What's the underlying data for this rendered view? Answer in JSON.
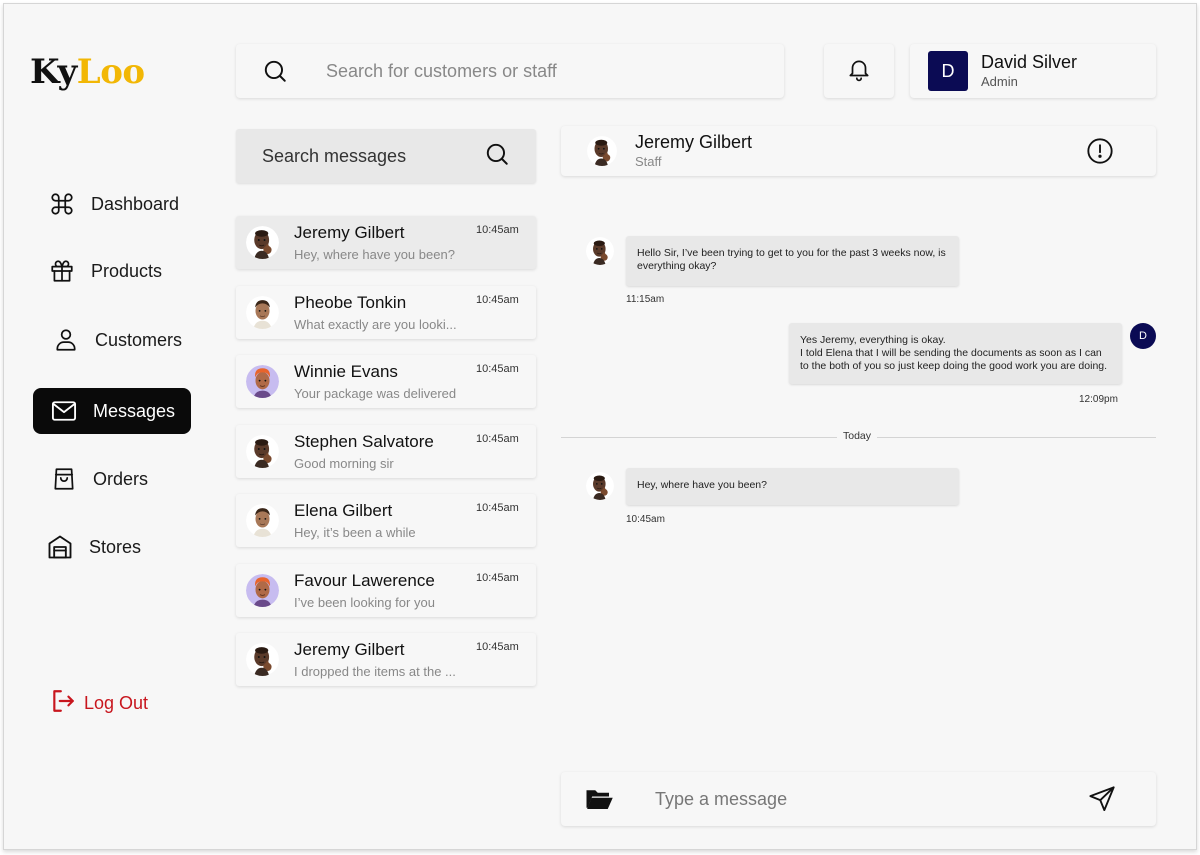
{
  "brand": {
    "part1": "Ky",
    "part2": "Loo"
  },
  "sidebar": {
    "items": [
      {
        "label": "Dashboard",
        "icon": "command-icon"
      },
      {
        "label": "Products",
        "icon": "gift-icon"
      },
      {
        "label": "Customers",
        "icon": "user-icon"
      },
      {
        "label": "Messages",
        "icon": "mail-icon",
        "active": true
      },
      {
        "label": "Orders",
        "icon": "shopping-bag-icon"
      },
      {
        "label": "Stores",
        "icon": "store-icon"
      }
    ],
    "logout": "Log Out"
  },
  "topbar": {
    "search_placeholder": "Search for customers or staff",
    "user": {
      "initial": "D",
      "name": "David Silver",
      "role": "Admin"
    }
  },
  "messages_search": {
    "placeholder": "Search messages"
  },
  "conversations": [
    {
      "name": "Jeremy Gilbert",
      "preview": "Hey, where have you been?",
      "time": "10:45am",
      "active": true
    },
    {
      "name": "Pheobe Tonkin",
      "preview": "What exactly are you looki...",
      "time": "10:45am"
    },
    {
      "name": "Winnie Evans",
      "preview": "Your package was delivered",
      "time": "10:45am"
    },
    {
      "name": "Stephen Salvatore",
      "preview": "Good morning sir",
      "time": "10:45am"
    },
    {
      "name": "Elena Gilbert",
      "preview": "Hey, it’s been a while",
      "time": "10:45am"
    },
    {
      "name": "Favour Lawerence",
      "preview": "I’ve been looking for you",
      "time": "10:45am"
    },
    {
      "name": "Jeremy Gilbert",
      "preview": "I dropped the items at the ...",
      "time": "10:45am"
    }
  ],
  "chat": {
    "contact": {
      "name": "Jeremy Gilbert",
      "role": "Staff"
    },
    "messages": [
      {
        "from": "contact",
        "text": "Hello Sir, I’ve been trying to get to you for the past 3 weeks now, is everything okay?",
        "time": "11:15am"
      },
      {
        "from": "me",
        "avatar": "D",
        "text_line1": "Yes Jeremy, everything is okay.",
        "text_line2": "I told Elena that I will be sending the documents as soon as I can to the both of you so just keep doing the good work you are doing.",
        "time": "12:09pm"
      },
      {
        "from": "contact",
        "text": "Hey, where have you been?",
        "time": "10:45am"
      }
    ],
    "divider_label": "Today",
    "composer_placeholder": "Type a message"
  },
  "colors": {
    "accent": "#0b0b54",
    "brand_yellow": "#f2b705",
    "logout_red": "#c8161e",
    "active_nav": "#0a0a0a"
  }
}
